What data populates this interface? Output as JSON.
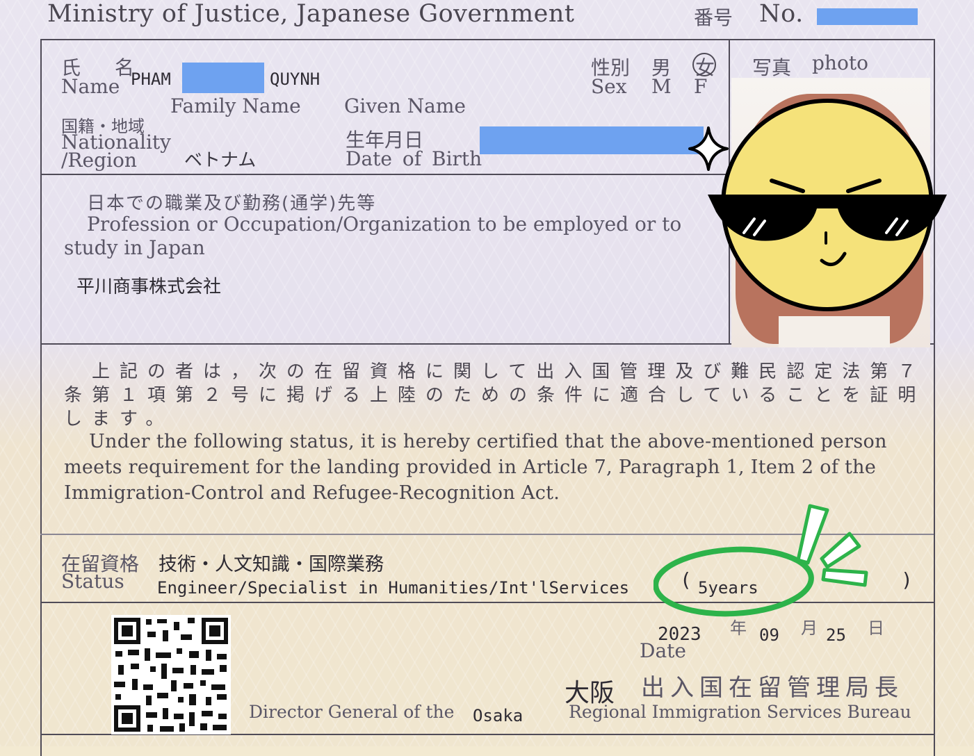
{
  "header": {
    "ministry": "Ministry of Justice, Japanese Government",
    "number_jp": "番号",
    "number_en": "No.",
    "number_value_redacted": true
  },
  "name": {
    "label_jp": "氏 名",
    "label_en": "Name",
    "family_visible": "PHAM",
    "given_visible": "QUYNH",
    "family_caption": "Family Name",
    "given_caption": "Given Name"
  },
  "sex": {
    "label_jp": "性別",
    "label_en": "Sex",
    "male_jp": "男",
    "male_en": "M",
    "female_jp": "女",
    "female_en": "F",
    "selected": "F"
  },
  "photo": {
    "label_jp": "写真",
    "label_en": "photo"
  },
  "nationality": {
    "label_jp": "国籍・地域",
    "label_en_1": "Nationality",
    "label_en_2": "/Region",
    "value": "ベトナム"
  },
  "dob": {
    "label_jp": "生年月日",
    "label_en": "Date of Birth"
  },
  "occupation": {
    "label_jp": "日本での職業及び勤務(通学)先等",
    "label_en_1": "Profession or Occupation/Organization to be employed or to",
    "label_en_2": "study in Japan",
    "value": "平川商事株式会社"
  },
  "certification": {
    "jp_1": "上記の者は，次の在留資格に関して出入国管理及び難民認定法第７",
    "jp_2": "条第１項第２号に掲げる上陸のための条件に適合していることを証明",
    "jp_3": "します。",
    "en_1": "Under the following status, it is hereby certified that the above-mentioned person",
    "en_2": "meets requirement for the landing provided in Article 7, Paragraph 1, Item 2 of the",
    "en_3": "Immigration-Control and Refugee-Recognition Act."
  },
  "status": {
    "label_jp": "在留資格",
    "label_en": "Status",
    "value_jp": "技術・人文知識・国際業務",
    "value_en": "Engineer/Specialist in Humanities/Int'lServices",
    "paren_open": "(",
    "duration": "5years",
    "paren_close": ")"
  },
  "date": {
    "year": "2023",
    "year_jp": "年",
    "month": "09",
    "month_jp": "月",
    "day": "25",
    "day_jp": "日",
    "label": "Date"
  },
  "issuer": {
    "city_jp": "大阪",
    "bureau_jp": "出入国在留管理局長",
    "director_en": "Director General of the",
    "city_en": "Osaka",
    "bureau_en": "Regional Immigration Services Bureau"
  },
  "colors": {
    "redaction": "#6ea2f0",
    "highlight_green": "#2db34a",
    "emoji_face": "#f5e27a"
  },
  "icons": [
    "sparkle-icon",
    "sunglasses-emoji-icon",
    "qr-code",
    "emphasis-lines-icon"
  ]
}
